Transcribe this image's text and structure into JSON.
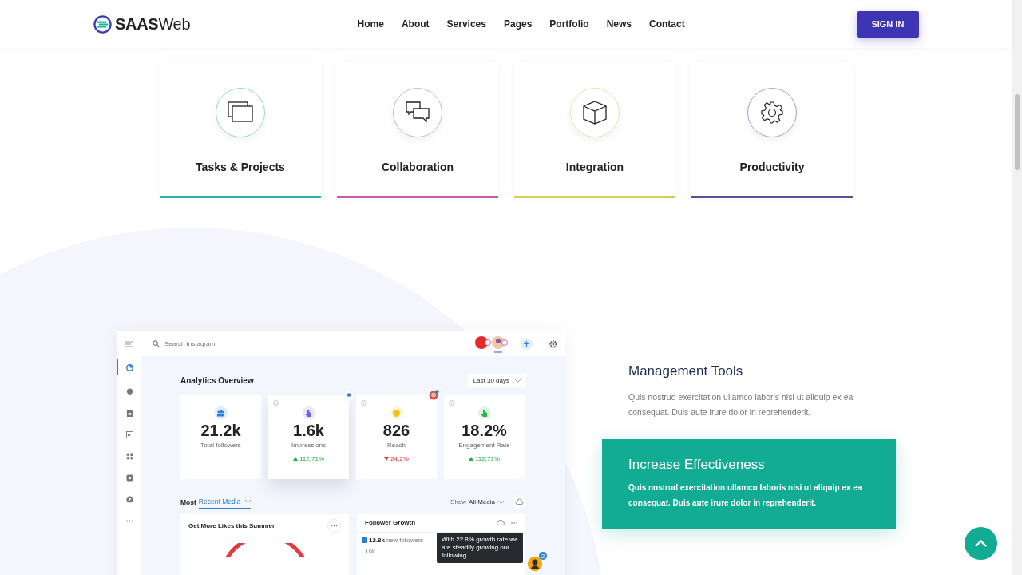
{
  "header": {
    "logo": "**SAAS**Web",
    "nav": [
      {
        "label": "Home"
      },
      {
        "label": "About"
      },
      {
        "label": "Services"
      },
      {
        "label": "Pages"
      },
      {
        "label": "Portfolio"
      },
      {
        "label": "News"
      },
      {
        "label": "Contact"
      }
    ],
    "sign_in": "SIGN IN"
  },
  "features": [
    {
      "title": "Tasks & Projects",
      "kind": "windows",
      "color": "#2bb5a9"
    },
    {
      "title": "Collaboration",
      "kind": "chat",
      "color": "#c65bb0"
    },
    {
      "title": "Integration",
      "kind": "cube",
      "color": "#d3cd5c"
    },
    {
      "title": "Productivity",
      "kind": "gear",
      "color": "#5a4f9c"
    }
  ],
  "dashboard": {
    "sidebar": [
      {
        "kind": "chart",
        "selected": true
      },
      {
        "kind": "bubble",
        "selected": false
      },
      {
        "kind": "file",
        "selected": false
      },
      {
        "kind": "image",
        "selected": false
      },
      {
        "kind": "grid",
        "selected": false
      },
      {
        "kind": "camera",
        "selected": false
      },
      {
        "kind": "compass",
        "selected": false
      },
      {
        "kind": "more",
        "selected": false
      }
    ],
    "search": {
      "placeholder": "Search Instagram"
    },
    "title": "Analytics Overview",
    "range": "Last 30 days",
    "stats": [
      {
        "kind": "people",
        "color": "#2f7fd8",
        "value": "21.2k",
        "label": "Total followers",
        "info": false,
        "highlighted": false
      },
      {
        "kind": "pointer",
        "color": "#7b5ee0",
        "value": "1.6k",
        "label": "Impressions",
        "change": "112,71%",
        "rising": true,
        "info": true,
        "highlighted": true
      },
      {
        "kind": "smile",
        "color": "#f2c21b",
        "value": "826",
        "label": "Reach",
        "change": "24,2%",
        "rising": false,
        "info": true,
        "highlighted": false
      },
      {
        "kind": "hand",
        "color": "#29b34a",
        "value": "18.2%",
        "label": "Engagement Rate",
        "change": "112,71%",
        "rising": true,
        "info": true,
        "highlighted": false
      }
    ],
    "media": {
      "prefix": "Most",
      "selection": "Recent Media",
      "filter_prefix": "Show",
      "filter": "All Media"
    },
    "cards": [
      {
        "title": "Get More Likes this Summer"
      },
      {
        "title": "Follower Growth",
        "legend_value": "12.8k",
        "legend_label": "new followers",
        "axis_label": "10k"
      }
    ],
    "tooltip": "With 22.8% growth rate we are steadily growing our following.",
    "badge": "2"
  },
  "info": {
    "title": "Management Tools",
    "text": "Quis nostrud exercitation ullamco laboris nisi ut aliquip ex ea consequat. Duis aute irure dolor in reprehenderit."
  },
  "highlight": {
    "title": "Increase Effectiveness",
    "text": "Quis nostrud exercitation ullamco laboris nisi ut aliquip ex ea consequat. Duis aute irure dolor in reprehenderit."
  }
}
